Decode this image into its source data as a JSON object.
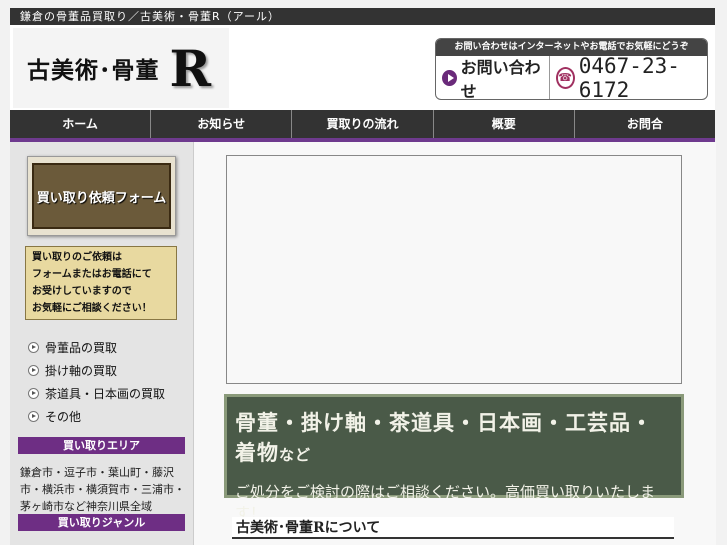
{
  "topbar": {
    "text": "鎌倉の骨董品買取り／古美術・骨董R（アール）"
  },
  "logo": {
    "text": "古美術･骨董",
    "letter": "R"
  },
  "contact": {
    "top_text": "お問い合わせはインターネットやお電話でお気軽にどうぞ",
    "button_label": "お問い合わせ",
    "phone": "0467-23-6172"
  },
  "nav": [
    "ホーム",
    "お知らせ",
    "買取りの流れ",
    "概要",
    "お問合"
  ],
  "sidebar": {
    "form_button": "買い取り依頼フォーム",
    "notice": [
      "買い取りのご依頼は",
      "フォームまたはお電話にて",
      "お受けしていますので",
      "お気軽にご相談ください！"
    ],
    "links": [
      "骨董品の買取",
      "掛け軸の買取",
      "茶道具・日本画の買取",
      "その他"
    ],
    "area_heading": "買い取りエリア",
    "area_text": "鎌倉市・逗子市・葉山町・藤沢市・横浜市・横須賀市・三浦市・茅ヶ崎市など神奈川県全域",
    "genre_heading": "買い取りジャンル"
  },
  "board": {
    "line1": "骨董・掛け軸・茶道具・日本画・工芸品・着物",
    "line1_suffix": "など",
    "line2": "ご処分をご検討の際はご相談ください。高価買い取りいたします！"
  },
  "about": {
    "title": "古美術･骨董Rについて"
  }
}
